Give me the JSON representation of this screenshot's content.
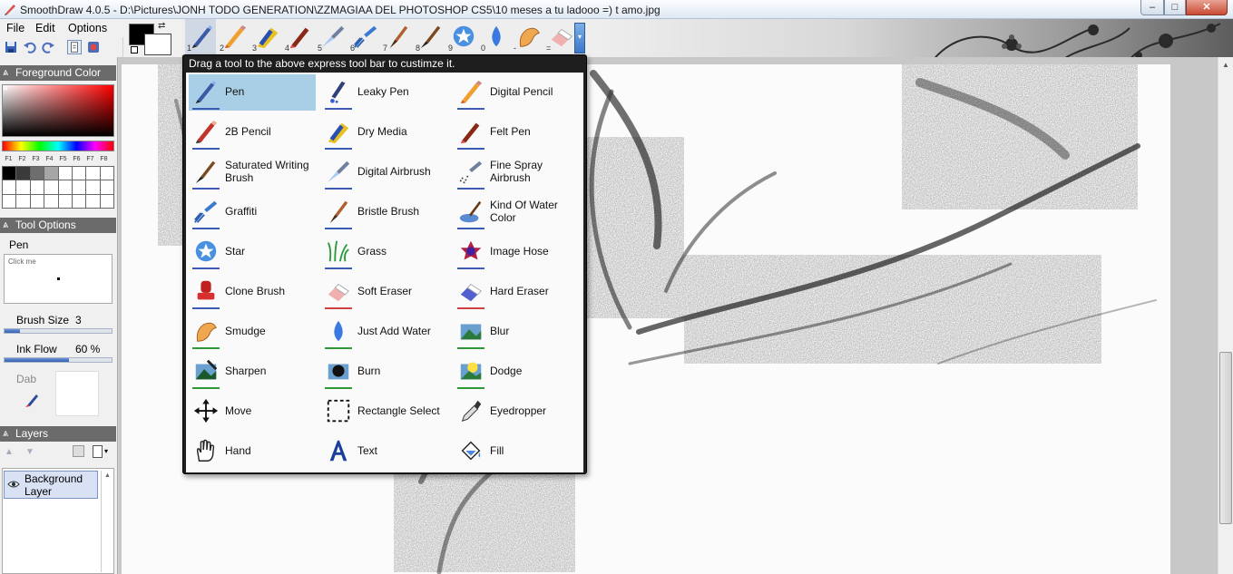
{
  "window": {
    "title": "SmoothDraw 4.0.5 - D:\\Pictures\\JONH TODO GENERATION\\ZZMAGIAA DEL PHOTOSHOP CS5\\10 meses a tu ladooo =) t amo.jpg",
    "minimize": "–",
    "maximize": "□",
    "close": "✕"
  },
  "menu": {
    "file": "File",
    "edit": "Edit",
    "options": "Options"
  },
  "express_tools": {
    "numbers": [
      "1",
      "2",
      "3",
      "4",
      "5",
      "6",
      "7",
      "8",
      "9",
      "0",
      "-",
      "="
    ],
    "icons": [
      "pen-icon",
      "digital-pencil-icon",
      "dry-media-icon",
      "felt-pen-icon",
      "digital-airbrush-icon",
      "graffiti-icon",
      "bristle-brush-icon",
      "saturated-writing-brush-icon",
      "star-icon",
      "just-add-water-icon",
      "smudge-icon",
      "soft-eraser-icon"
    ],
    "dropdown": "▾"
  },
  "popup": {
    "hint": "Drag a tool to the above express tool bar to custimze it.",
    "tools": [
      {
        "label": "Pen",
        "icon": "pen-icon",
        "selected": true,
        "color": "#3b5bb5"
      },
      {
        "label": "Leaky Pen",
        "icon": "leaky-pen-icon",
        "selected": false,
        "color": "#3b5bb5"
      },
      {
        "label": "Digital Pencil",
        "icon": "digital-pencil-icon",
        "selected": false,
        "color": "#3b5bb5"
      },
      {
        "label": "2B Pencil",
        "icon": "pencil-2b-icon",
        "selected": false,
        "color": "#3b5bb5"
      },
      {
        "label": "Dry Media",
        "icon": "dry-media-icon",
        "selected": false,
        "color": "#3b5bb5"
      },
      {
        "label": "Felt Pen",
        "icon": "felt-pen-icon",
        "selected": false,
        "color": "#3b5bb5"
      },
      {
        "label": "Saturated Writing Brush",
        "icon": "saturated-writing-brush-icon",
        "selected": false,
        "color": "#3b5bb5"
      },
      {
        "label": "Digital Airbrush",
        "icon": "digital-airbrush-icon",
        "selected": false,
        "color": "#3b5bb5"
      },
      {
        "label": "Fine Spray Airbrush",
        "icon": "fine-spray-airbrush-icon",
        "selected": false,
        "color": "#3b5bb5"
      },
      {
        "label": "Graffiti",
        "icon": "graffiti-icon",
        "selected": false,
        "color": "#3b5bb5"
      },
      {
        "label": "Bristle Brush",
        "icon": "bristle-brush-icon",
        "selected": false,
        "color": "#3b5bb5"
      },
      {
        "label": "Kind Of Water Color",
        "icon": "water-color-icon",
        "selected": false,
        "color": "#3b5bb5"
      },
      {
        "label": "Star",
        "icon": "star-icon",
        "selected": false,
        "color": "#3b5bb5"
      },
      {
        "label": "Grass",
        "icon": "grass-icon",
        "selected": false,
        "color": "#3b5bb5"
      },
      {
        "label": "Image Hose",
        "icon": "image-hose-icon",
        "selected": false,
        "color": "#3b5bb5"
      },
      {
        "label": "Clone Brush",
        "icon": "clone-brush-icon",
        "selected": false,
        "color": "#3b5bb5"
      },
      {
        "label": "Soft Eraser",
        "icon": "soft-eraser-icon",
        "selected": false,
        "color": "#d04040"
      },
      {
        "label": "Hard Eraser",
        "icon": "hard-eraser-icon",
        "selected": false,
        "color": "#d04040"
      },
      {
        "label": "Smudge",
        "icon": "smudge-icon",
        "selected": false,
        "color": "#2f9a35"
      },
      {
        "label": "Just Add Water",
        "icon": "just-add-water-icon",
        "selected": false,
        "color": "#2f9a35"
      },
      {
        "label": "Blur",
        "icon": "blur-icon",
        "selected": false,
        "color": "#2f9a35"
      },
      {
        "label": "Sharpen",
        "icon": "sharpen-icon",
        "selected": false,
        "color": "#2f9a35"
      },
      {
        "label": "Burn",
        "icon": "burn-icon",
        "selected": false,
        "color": "#2f9a35"
      },
      {
        "label": "Dodge",
        "icon": "dodge-icon",
        "selected": false,
        "color": "#2f9a35"
      },
      {
        "label": "Move",
        "icon": "move-icon",
        "selected": false,
        "color": "none"
      },
      {
        "label": "Rectangle Select",
        "icon": "rectangle-select-icon",
        "selected": false,
        "color": "none"
      },
      {
        "label": "Eyedropper",
        "icon": "eyedropper-icon",
        "selected": false,
        "color": "none"
      },
      {
        "label": "Hand",
        "icon": "hand-icon",
        "selected": false,
        "color": "none"
      },
      {
        "label": "Text",
        "icon": "text-icon",
        "selected": false,
        "color": "none"
      },
      {
        "label": "Fill",
        "icon": "fill-icon",
        "selected": false,
        "color": "none"
      }
    ]
  },
  "foreground_color": {
    "header": "Foreground Color",
    "collapse": "»",
    "fkeys": [
      "F1",
      "F2",
      "F3",
      "F4",
      "F5",
      "F6",
      "F7",
      "F8"
    ],
    "palette": [
      "#000000",
      "#3a3a3a",
      "#6e6e6e",
      "#a6a6a6",
      "#ffffff",
      "#ffffff",
      "#ffffff",
      "#ffffff",
      "#ffffff",
      "#ffffff",
      "#ffffff",
      "#ffffff",
      "#ffffff",
      "#ffffff",
      "#ffffff",
      "#ffffff",
      "#ffffff",
      "#ffffff",
      "#ffffff",
      "#ffffff",
      "#ffffff",
      "#ffffff",
      "#ffffff",
      "#ffffff"
    ],
    "current": "#000000",
    "background": "#ffffff"
  },
  "tool_options": {
    "header": "Tool Options",
    "collapse": "»",
    "tool_name": "Pen",
    "click_pad_label": "Click me",
    "brush_size_label": "Brush Size",
    "brush_size_value": "3",
    "brush_size_fraction": 0.14,
    "ink_flow_label": "Ink Flow",
    "ink_flow_value": "60 %",
    "ink_flow_fraction": 0.6,
    "dab_label": "Dab"
  },
  "layers": {
    "header": "Layers",
    "collapse": "»",
    "items": [
      {
        "name": "Background Layer"
      }
    ]
  }
}
